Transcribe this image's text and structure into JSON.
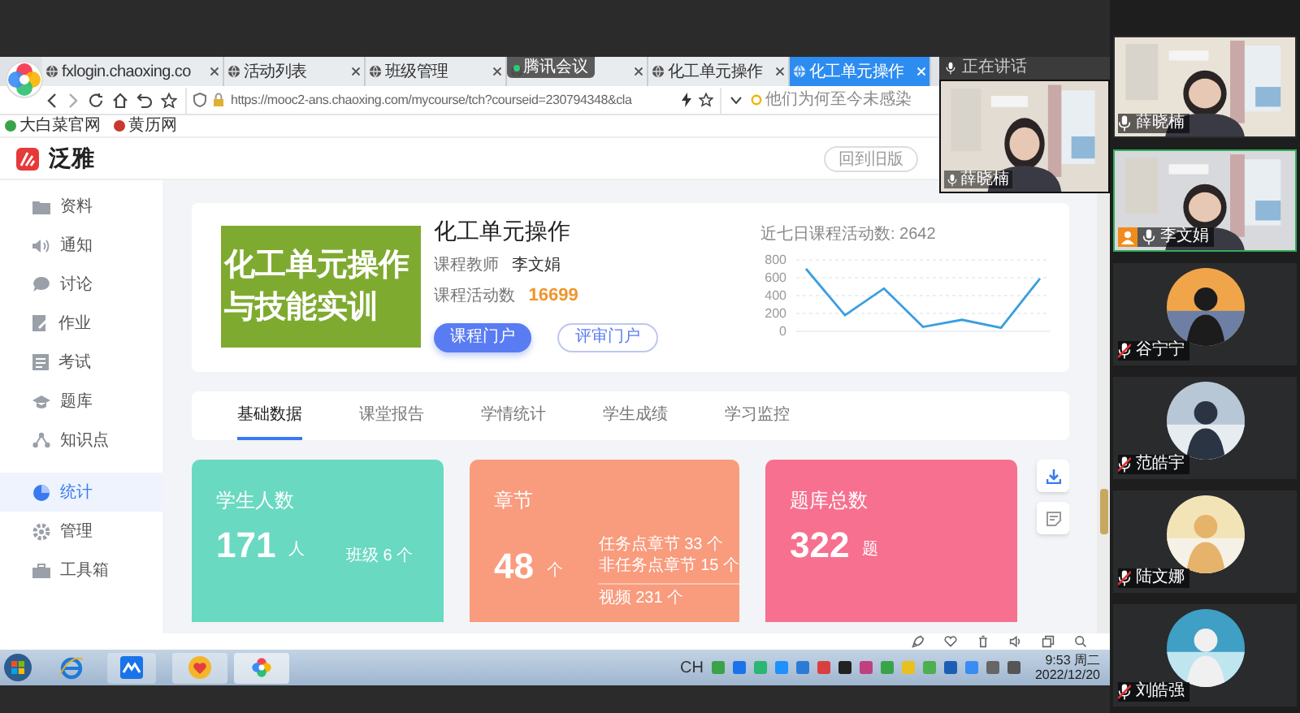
{
  "meeting": {
    "badge": "腾讯会议",
    "speaking_label": "正在讲话",
    "floating_video": {
      "name": "薛晓楠",
      "muted": false
    }
  },
  "browser": {
    "tabs": [
      {
        "label": "fxlogin.chaoxing.co",
        "selected": false
      },
      {
        "label": "活动列表",
        "selected": false
      },
      {
        "label": "班级管理",
        "selected": false
      },
      {
        "selected": false
      },
      {
        "label": "化工单元操作",
        "selected": false
      },
      {
        "label": "化工单元操作",
        "selected": true
      }
    ],
    "url": "https://mooc2-ans.chaoxing.com/mycourse/tch?courseid=230794348&cla",
    "search_placeholder": "他们为何至今未感染",
    "bookmarks": [
      "大白菜官网",
      "黄历网"
    ]
  },
  "app": {
    "logo": "泛雅",
    "old_version_button": "回到旧版"
  },
  "sidebar": {
    "items": [
      {
        "label": "资料",
        "selected": false
      },
      {
        "label": "通知",
        "selected": false
      },
      {
        "label": "讨论",
        "selected": false
      },
      {
        "label": "作业",
        "selected": false
      },
      {
        "label": "考试",
        "selected": false
      },
      {
        "label": "题库",
        "selected": false
      },
      {
        "label": "知识点",
        "selected": false
      },
      {
        "label": "统计",
        "selected": true
      },
      {
        "label": "管理",
        "selected": false
      },
      {
        "label": "工具箱",
        "selected": false
      }
    ]
  },
  "course": {
    "cover_lines": [
      "化工单元操作",
      "与技能实训"
    ],
    "title": "化工单元操作",
    "teacher_label": "课程教师",
    "teacher": "李文娟",
    "activity_label": "课程活动数",
    "activity_count": "16699",
    "buttons": [
      "课程门户",
      "评审门户"
    ],
    "chart_data": {
      "type": "line",
      "title": "近七日课程活动数: 2642",
      "ylim": [
        0,
        800
      ],
      "yticks": [
        0,
        200,
        400,
        600,
        800
      ],
      "grid": true,
      "series": [
        {
          "color": "#3b9ee0",
          "values": [
            700,
            180,
            480,
            50,
            130,
            40,
            590
          ]
        }
      ]
    }
  },
  "tabs": [
    {
      "label": "基础数据",
      "selected": true
    },
    {
      "label": "课堂报告",
      "selected": false
    },
    {
      "label": "学情统计",
      "selected": false
    },
    {
      "label": "学生成绩",
      "selected": false
    },
    {
      "label": "学习监控",
      "selected": false
    }
  ],
  "stat_cards": [
    {
      "title": "学生人数",
      "value": "171",
      "unit": "人",
      "color": "#6ad9c1",
      "details": [
        "班级 6 个"
      ]
    },
    {
      "title": "章节",
      "value": "48",
      "unit": "个",
      "color": "#f99b7d",
      "details": [
        "任务点章节 33 个",
        "非任务点章节 15 个",
        "视频 231 个"
      ]
    },
    {
      "title": "题库总数",
      "value": "322",
      "unit": "题",
      "color": "#f7708f"
    }
  ],
  "taskbar": {
    "ime": "CH",
    "time": "9:53 周二",
    "date": "2022/12/20"
  },
  "participants": [
    {
      "name": "薛晓楠",
      "kind": "video",
      "muted": false,
      "selected": false,
      "host": false
    },
    {
      "name": "李文娟",
      "kind": "video",
      "muted": false,
      "selected": true,
      "host": true
    },
    {
      "name": "谷宁宁",
      "kind": "avatar",
      "muted": true,
      "selected": false,
      "host": false
    },
    {
      "name": "范皓宇",
      "kind": "avatar",
      "muted": true,
      "selected": false,
      "host": false
    },
    {
      "name": "陆文娜",
      "kind": "avatar",
      "muted": true,
      "selected": false,
      "host": false
    },
    {
      "name": "刘皓强",
      "kind": "avatar",
      "muted": true,
      "selected": false,
      "host": false
    }
  ]
}
